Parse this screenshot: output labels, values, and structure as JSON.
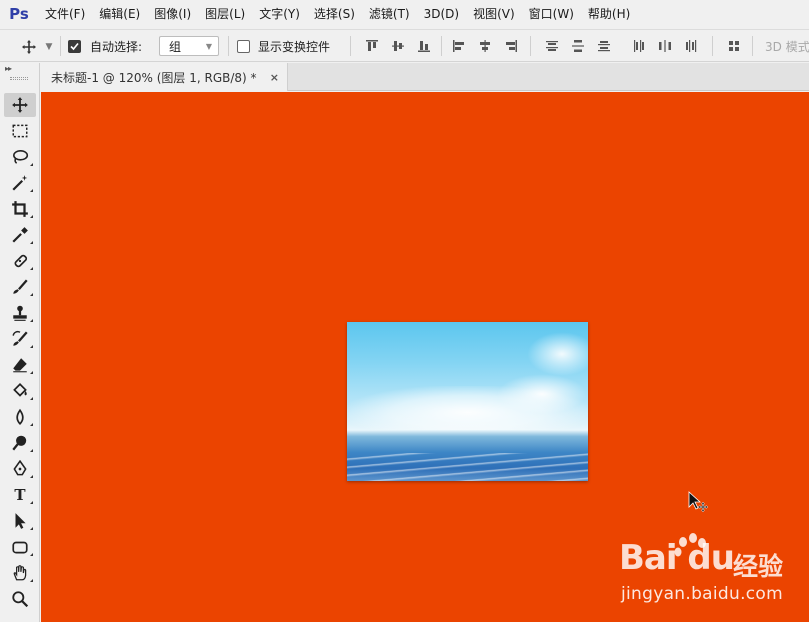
{
  "app": {
    "logo": "Ps"
  },
  "menu": [
    "文件(F)",
    "编辑(E)",
    "图像(I)",
    "图层(L)",
    "文字(Y)",
    "选择(S)",
    "滤镜(T)",
    "3D(D)",
    "视图(V)",
    "窗口(W)",
    "帮助(H)"
  ],
  "options": {
    "auto_select_label": "自动选择:",
    "auto_select_checked": true,
    "auto_select_value": "组",
    "show_transform_label": "显示变换控件",
    "show_transform_checked": false,
    "mode_3d_label": "3D 模式"
  },
  "document": {
    "tab_title": "未标题-1 @ 120% (图层 1, RGB/8) *",
    "close_glyph": "×",
    "canvas_color": "#eb4400"
  },
  "tools": [
    "move-tool",
    "marquee-tool",
    "lasso-tool",
    "magic-wand-tool",
    "crop-tool",
    "eyedropper-tool",
    "healing-brush-tool",
    "brush-tool",
    "clone-stamp-tool",
    "history-brush-tool",
    "eraser-tool",
    "paint-bucket-tool",
    "blur-tool",
    "dodge-tool",
    "pen-tool",
    "type-tool",
    "path-selection-tool",
    "rectangle-tool",
    "hand-tool",
    "zoom-tool"
  ],
  "type_tool_glyph": "T",
  "watermark": {
    "brand": "Bai du",
    "suffix": "经验",
    "url": "jingyan.baidu.com"
  }
}
